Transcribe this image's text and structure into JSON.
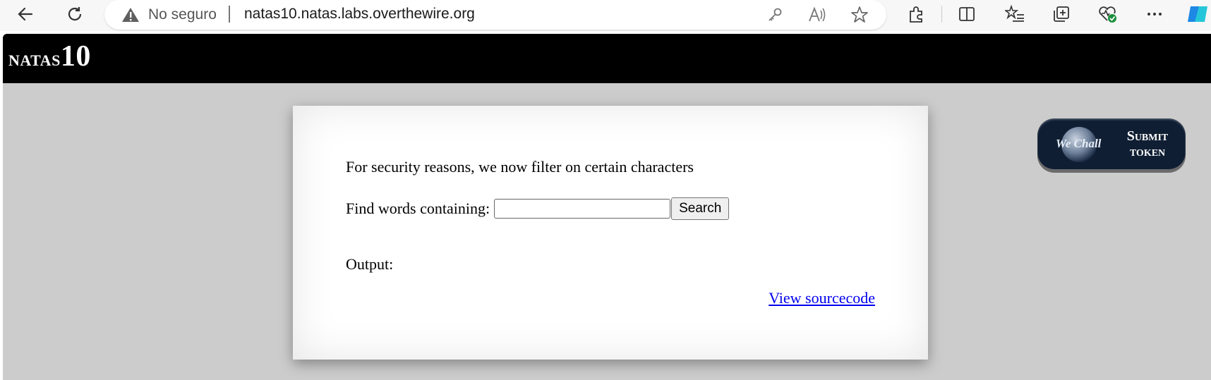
{
  "browser": {
    "security_label": "No seguro",
    "url": "natas10.natas.labs.overthewire.org",
    "icons": [
      "back-icon",
      "refresh-icon",
      "warning-icon",
      "key-icon",
      "read-aloud-icon",
      "favorite-star-icon",
      "extensions-icon",
      "split-screen-icon",
      "favorites-list-icon",
      "collections-icon",
      "browser-essentials-icon",
      "more-icon",
      "copilot-icon"
    ]
  },
  "header": {
    "title_prefix": "natas",
    "title_number": "10"
  },
  "content": {
    "message": "For security reasons, we now filter on certain characters",
    "find_label": "Find words containing:",
    "search_value": "",
    "search_button": "Search",
    "output_label": "Output:",
    "source_link": "View sourcecode"
  },
  "wechall": {
    "logo_text": "We Chall",
    "submit_line1": "Submit",
    "submit_line2": "token"
  },
  "colors": {
    "page_bg": "#cccccc",
    "header_bg": "#000000",
    "link": "#0000ee",
    "wechall_bg": "#0f1e33"
  }
}
